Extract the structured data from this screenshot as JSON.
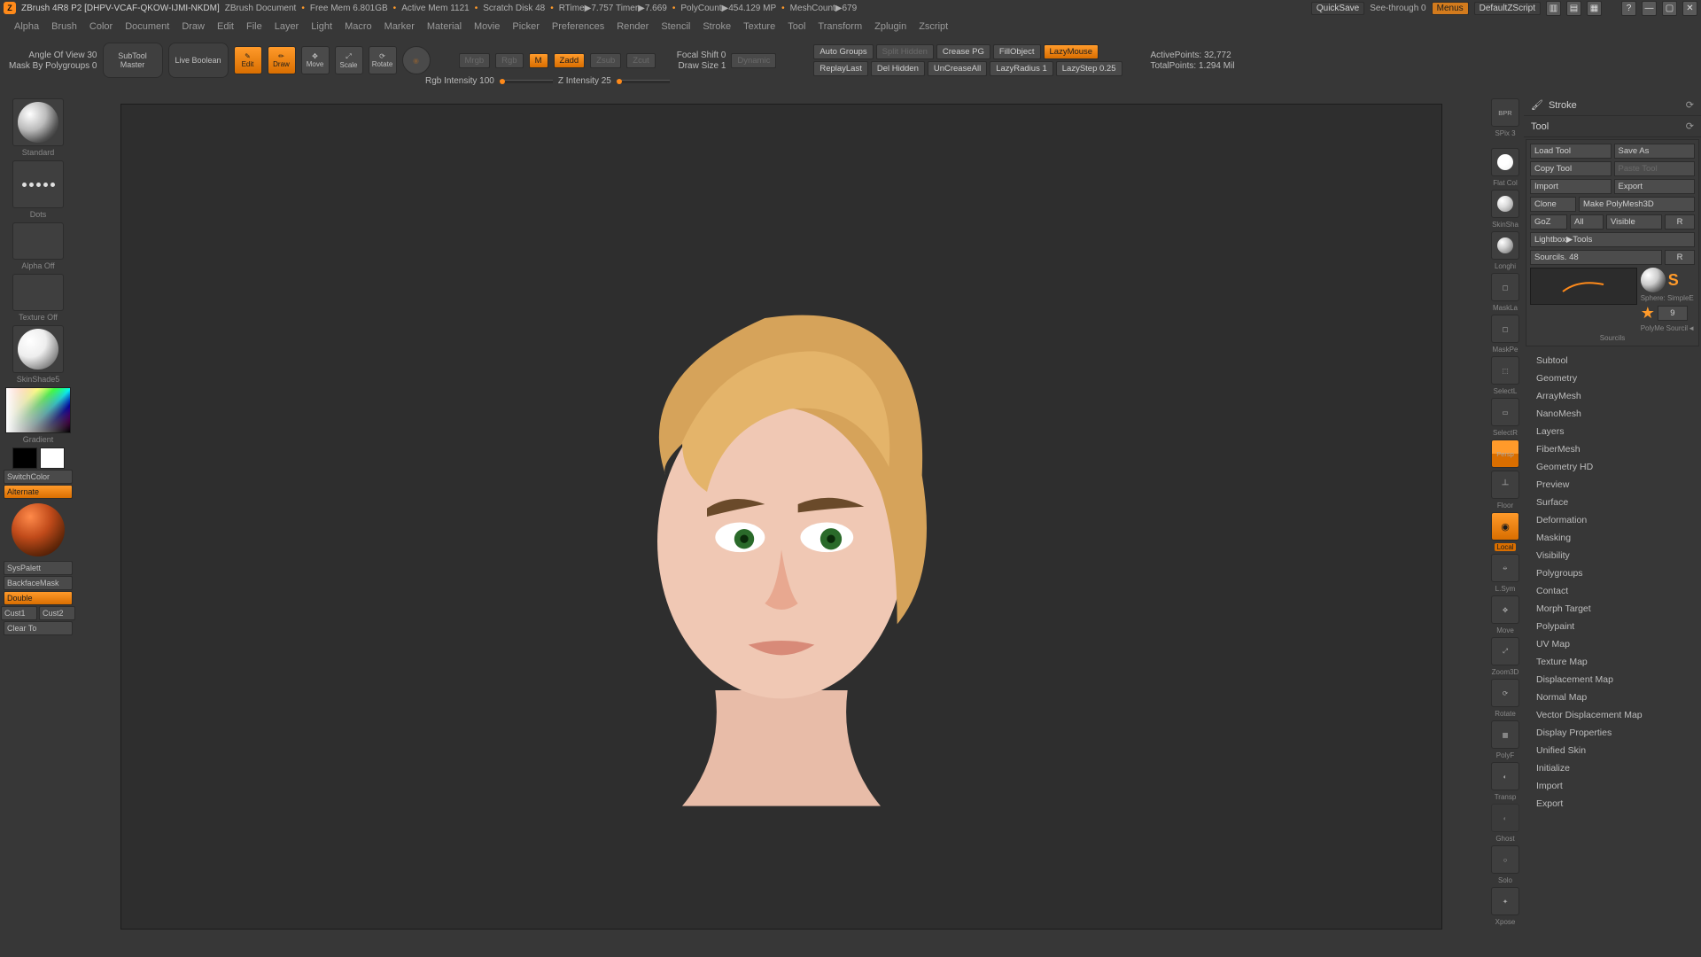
{
  "title_bar": {
    "app": "ZBrush 4R8 P2 [DHPV-VCAF-QKOW-IJMI-NKDM]",
    "doc": "ZBrush Document",
    "mem": "Free Mem 6.801GB",
    "active": "Active Mem 1121",
    "scratch": "Scratch Disk 48",
    "rtime": "RTime▶7.757 Timer▶7.669",
    "poly": "PolyCount▶454.129 MP",
    "mesh": "MeshCount▶679"
  },
  "title_right": {
    "quicksave": "QuickSave",
    "seethrough": "See-through  0",
    "menus": "Menus",
    "defscript": "DefaultZScript"
  },
  "menus": [
    "Alpha",
    "Brush",
    "Color",
    "Document",
    "Draw",
    "Edit",
    "File",
    "Layer",
    "Light",
    "Macro",
    "Marker",
    "Material",
    "Movie",
    "Picker",
    "Preferences",
    "Render",
    "Stencil",
    "Stroke",
    "Texture",
    "Tool",
    "Transform",
    "Zplugin",
    "Zscript"
  ],
  "shelf": {
    "angle": "Angle Of View 30",
    "maskpg": "Mask By Polygroups  0",
    "subtool": "SubTool\nMaster",
    "livebool": "Live Boolean",
    "edit": "Edit",
    "draw": "Draw",
    "move": "Move",
    "scale": "Scale",
    "rotate": "Rotate",
    "mrgb": "Mrgb",
    "rgb": "Rgb",
    "m": "M",
    "zadd": "Zadd",
    "zsub": "Zsub",
    "zcut": "Zcut",
    "rgbint": "Rgb Intensity  100",
    "zint": "Z Intensity  25",
    "focal": "Focal Shift  0",
    "drawsize": "Draw Size  1",
    "dynamic": "Dynamic",
    "autogroups": "Auto Groups",
    "splithidden": "Split Hidden",
    "creasepg": "Crease PG",
    "fillobj": "FillObject",
    "lazymouse": "LazyMouse",
    "replaylast": "ReplayLast",
    "delhidden": "Del Hidden",
    "uncrease": "UnCreaseAll",
    "lazyrad": "LazyRadius  1",
    "lazystep": "LazyStep  0.25",
    "activepts": "ActivePoints: 32,772",
    "totalpts": "TotalPoints: 1.294 Mil"
  },
  "left": {
    "standard": "Standard",
    "dots": "Dots",
    "alpha": "Alpha Off",
    "texture": "Texture Off",
    "skinshade": "SkinShade5",
    "gradient": "Gradient",
    "switch": "SwitchColor",
    "alternate": "Alternate",
    "syspal": "SysPalett",
    "backface": "BackfaceMask",
    "double": "Double",
    "cust1": "Cust1",
    "cust2": "Cust2",
    "clear": "Clear To"
  },
  "dock": {
    "bpr": "BPR",
    "spix": "SPix 3",
    "flatcol": "Flat Col",
    "skinsha": "SkinSha",
    "longhi": "Longhі",
    "maskla": "MaskLa",
    "maskpe": "MaskPe",
    "selectl": "SelectL",
    "selectr": "SelectR",
    "persp": "Persp",
    "floor": "Floor",
    "local": "Local",
    "lsym": "L.Sym",
    "move": "Move",
    "zoom": "Zoom3D",
    "rotate": "Rotate",
    "polyf": "PolyF",
    "transp": "Transp",
    "ghost": "Ghost",
    "solo": "Solo",
    "xpose": "Xpose"
  },
  "right": {
    "stroke": "Stroke",
    "tool": "Tool",
    "btns": {
      "load": "Load Tool",
      "saveas": "Save As",
      "copy": "Copy Tool",
      "paste": "Paste Tool",
      "import": "Import",
      "export": "Export",
      "clone": "Clone",
      "makepoly": "Make PolyMesh3D",
      "goz": "GoZ",
      "all": "All",
      "visible": "Visible",
      "r": "R",
      "lightbox": "Lightbox▶Tools",
      "sourcils": "Sourcils. 48",
      "r2": "R"
    },
    "thumbs": {
      "current": "Sourcils",
      "sphere": "Sphere: SimpleE",
      "polyme": "PolyMe",
      "count": "9",
      "sourcilb": "Sourcil◄"
    },
    "sections": [
      "Subtool",
      "Geometry",
      "ArrayMesh",
      "NanoMesh",
      "Layers",
      "FiberMesh",
      "Geometry HD",
      "Preview",
      "Surface",
      "Deformation",
      "Masking",
      "Visibility",
      "Polygroups",
      "Contact",
      "Morph Target",
      "Polypaint",
      "UV Map",
      "Texture Map",
      "Displacement Map",
      "Normal Map",
      "Vector Displacement Map",
      "Display Properties",
      "Unified Skin",
      "Initialize",
      "Import",
      "Export"
    ]
  }
}
